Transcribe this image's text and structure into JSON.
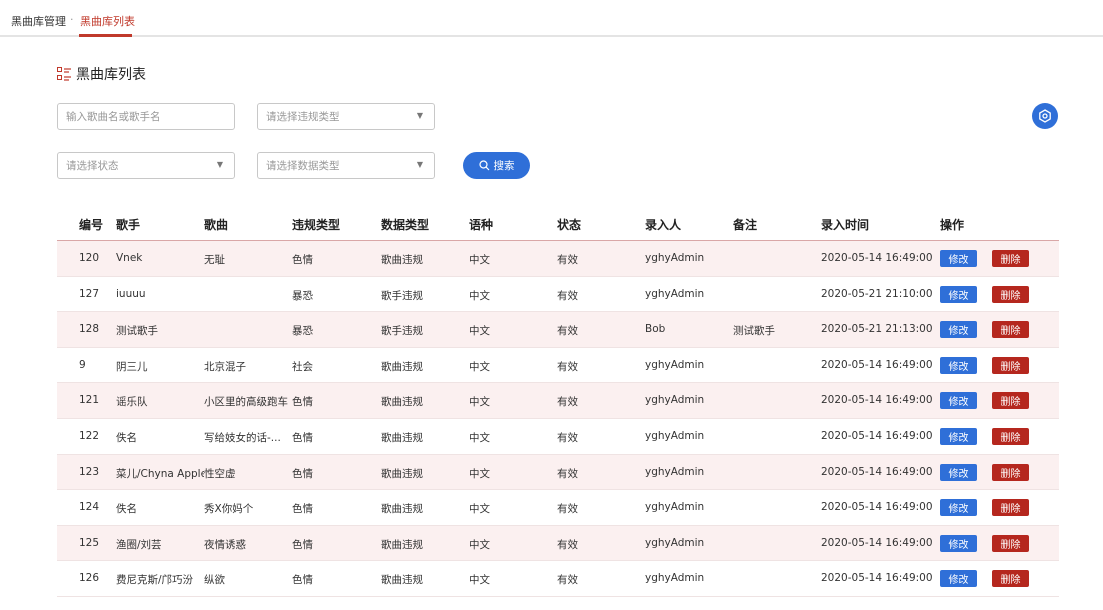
{
  "breadcrumb": {
    "root": "黑曲库管理",
    "separator": "·",
    "current": "黑曲库列表"
  },
  "page": {
    "title": "黑曲库列表",
    "title_icon": "list-icon"
  },
  "filters": {
    "keyword_placeholder": "输入歌曲名或歌手名",
    "violation_type_placeholder": "请选择违规类型",
    "status_placeholder": "请选择状态",
    "data_type_placeholder": "请选择数据类型",
    "search_label": "搜索"
  },
  "table": {
    "headers": {
      "id": "编号",
      "singer": "歌手",
      "song": "歌曲",
      "violation_type": "违规类型",
      "data_type": "数据类型",
      "language": "语种",
      "status": "状态",
      "entered_by": "录入人",
      "note": "备注",
      "entered_at": "录入时间",
      "actions": "操作"
    },
    "edit_label": "修改",
    "delete_label": "删除",
    "rows": [
      {
        "id": "120",
        "singer": "Vnek",
        "song": "无耻",
        "violation_type": "色情",
        "data_type": "歌曲违规",
        "language": "中文",
        "status": "有效",
        "entered_by": "yghyAdmin",
        "note": "",
        "entered_at": "2020-05-14 16:49:00"
      },
      {
        "id": "127",
        "singer": "iuuuu",
        "song": "",
        "violation_type": "暴恐",
        "data_type": "歌手违规",
        "language": "中文",
        "status": "有效",
        "entered_by": "yghyAdmin",
        "note": "",
        "entered_at": "2020-05-21 21:10:00"
      },
      {
        "id": "128",
        "singer": "测试歌手",
        "song": "",
        "violation_type": "暴恐",
        "data_type": "歌手违规",
        "language": "中文",
        "status": "有效",
        "entered_by": "Bob",
        "note": "测试歌手",
        "entered_at": "2020-05-21 21:13:00"
      },
      {
        "id": "9",
        "singer": "阴三儿",
        "song": "北京混子",
        "violation_type": "社会",
        "data_type": "歌曲违规",
        "language": "中文",
        "status": "有效",
        "entered_by": "yghyAdmin",
        "note": "",
        "entered_at": "2020-05-14 16:49:00"
      },
      {
        "id": "121",
        "singer": "谣乐队",
        "song": "小区里的高级跑车",
        "violation_type": "色情",
        "data_type": "歌曲违规",
        "language": "中文",
        "status": "有效",
        "entered_by": "yghyAdmin",
        "note": "",
        "entered_at": "2020-05-14 16:49:00"
      },
      {
        "id": "122",
        "singer": "佚名",
        "song": "写给妓女的话-...",
        "violation_type": "色情",
        "data_type": "歌曲违规",
        "language": "中文",
        "status": "有效",
        "entered_by": "yghyAdmin",
        "note": "",
        "entered_at": "2020-05-14 16:49:00"
      },
      {
        "id": "123",
        "singer": "菜儿/Chyna Apple",
        "song": "性空虚",
        "violation_type": "色情",
        "data_type": "歌曲违规",
        "language": "中文",
        "status": "有效",
        "entered_by": "yghyAdmin",
        "note": "",
        "entered_at": "2020-05-14 16:49:00"
      },
      {
        "id": "124",
        "singer": "佚名",
        "song": "秀X你妈个",
        "violation_type": "色情",
        "data_type": "歌曲违规",
        "language": "中文",
        "status": "有效",
        "entered_by": "yghyAdmin",
        "note": "",
        "entered_at": "2020-05-14 16:49:00"
      },
      {
        "id": "125",
        "singer": "渔圈/刘芸",
        "song": "夜情诱惑",
        "violation_type": "色情",
        "data_type": "歌曲违规",
        "language": "中文",
        "status": "有效",
        "entered_by": "yghyAdmin",
        "note": "",
        "entered_at": "2020-05-14 16:49:00"
      },
      {
        "id": "126",
        "singer": "费尼克斯/邝巧汾",
        "song": "纵欲",
        "violation_type": "色情",
        "data_type": "歌曲违规",
        "language": "中文",
        "status": "有效",
        "entered_by": "yghyAdmin",
        "note": "",
        "entered_at": "2020-05-14 16:49:00"
      }
    ]
  },
  "colors": {
    "accent": "#c0392b",
    "primary_button": "#2f6fd8",
    "delete_button": "#b5271e",
    "alt_row": "#fbf0f0"
  }
}
